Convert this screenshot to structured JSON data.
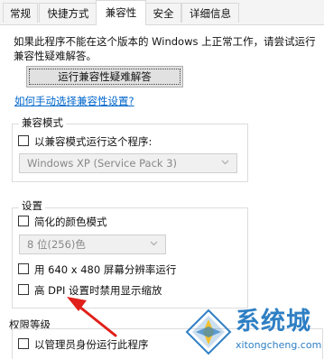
{
  "tabs": [
    {
      "label": "常规"
    },
    {
      "label": "快捷方式"
    },
    {
      "label": "兼容性"
    },
    {
      "label": "安全"
    },
    {
      "label": "详细信息"
    }
  ],
  "active_tab": "兼容性",
  "intro_text": "如果此程序不能在这个版本的 Windows 上正常工作，请尝试运行兼容性疑难解答。",
  "troubleshooter_button": "运行兼容性疑难解答",
  "manual_link": "如何手动选择兼容性设置?",
  "compat_mode": {
    "group_title": "兼容模式",
    "checkbox_label": "以兼容模式运行这个程序:",
    "checked": false,
    "os_select": "Windows XP (Service Pack 3)"
  },
  "settings": {
    "group_title": "设置",
    "reduced_color": {
      "label": "简化的颜色模式",
      "checked": false
    },
    "color_select": "8 位(256)色",
    "run_640": {
      "label": "用 640 x 480 屏幕分辨率运行",
      "checked": false
    },
    "high_dpi": {
      "label": "高 DPI 设置时禁用显示缩放",
      "checked": false
    }
  },
  "privilege": {
    "group_title": "权限等级",
    "admin": {
      "label": "以管理员身份运行此程序",
      "checked": false
    }
  },
  "watermark": {
    "brand": "系统城",
    "url": "xitongcheng.com"
  },
  "colors": {
    "link": "#0066cc",
    "arrow": "#e0201a",
    "watermark_blue": "#2e7fc4"
  }
}
